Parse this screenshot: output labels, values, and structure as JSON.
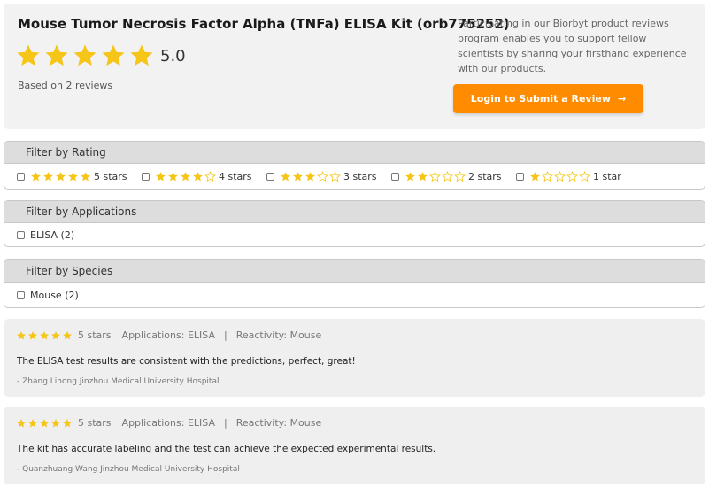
{
  "product": {
    "title": "Mouse Tumor Necrosis Factor Alpha (TNFa) ELISA Kit (orb775252)",
    "rating_value": "5.0",
    "based_on": "Based on 2 reviews",
    "stars": 5
  },
  "promo": {
    "text": "Participating in our Biorbyt product reviews program enables you to support fellow scientists by sharing your firsthand experience with our products.",
    "button_label": "Login to Submit a Review",
    "button_arrow": "→"
  },
  "filters": {
    "rating": {
      "heading": "Filter by Rating",
      "options": [
        {
          "label": "5 stars",
          "stars": 5
        },
        {
          "label": "4 stars",
          "stars": 4
        },
        {
          "label": "3 stars",
          "stars": 3
        },
        {
          "label": "2 stars",
          "stars": 2
        },
        {
          "label": "1 star",
          "stars": 1
        }
      ]
    },
    "applications": {
      "heading": "Filter by Applications",
      "options": [
        {
          "label": "ELISA (2)"
        }
      ]
    },
    "species": {
      "heading": "Filter by Species",
      "options": [
        {
          "label": "Mouse (2)"
        }
      ]
    }
  },
  "reviews": [
    {
      "stars": 5,
      "stars_label": "5 stars",
      "applications": "Applications: ELISA",
      "separator": "|",
      "reactivity": "Reactivity: Mouse",
      "text": "The ELISA test results are consistent with the predictions, perfect, great!",
      "author": "- Zhang Lihong  Jinzhou Medical University Hospital"
    },
    {
      "stars": 5,
      "stars_label": "5 stars",
      "applications": "Applications: ELISA",
      "separator": "|",
      "reactivity": "Reactivity: Mouse",
      "text": "The kit has accurate labeling and the test can achieve the expected experimental results.",
      "author": "- Quanzhuang Wang  Jinzhou Medical University Hospital"
    }
  ],
  "colors": {
    "star_filled": "#f5c518",
    "star_empty": "#f5c518",
    "accent": "#ff8c00"
  }
}
